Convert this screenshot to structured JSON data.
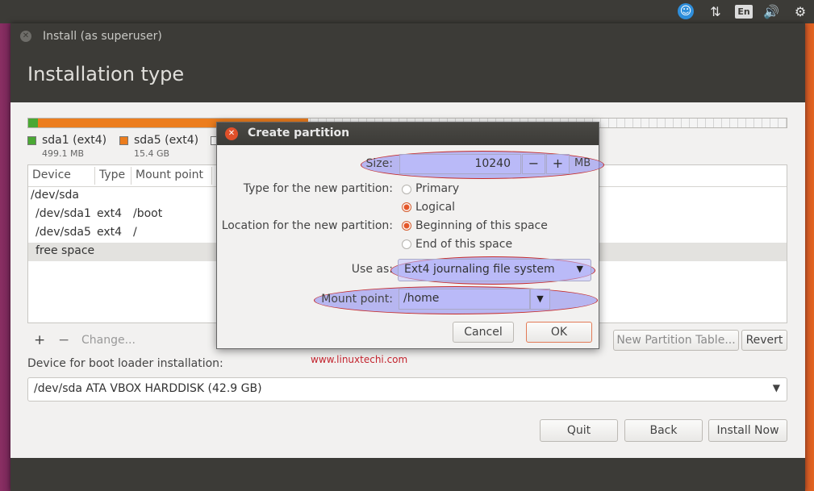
{
  "panel": {
    "language": "En"
  },
  "window": {
    "title": "Install (as superuser)",
    "page_title": "Installation type"
  },
  "legend": [
    {
      "name": "sda1 (ext4)",
      "size": "499.1 MB",
      "color": "#4aa834"
    },
    {
      "name": "sda5 (ext4)",
      "size": "15.4 GB",
      "color": "#ec7d1e"
    }
  ],
  "table": {
    "columns": [
      "Device",
      "Type",
      "Mount point"
    ],
    "rows": [
      {
        "device": "/dev/sda",
        "type": "",
        "mount": ""
      },
      {
        "device": "/dev/sda1",
        "type": "ext4",
        "mount": "/boot"
      },
      {
        "device": "/dev/sda5",
        "type": "ext4",
        "mount": "/"
      },
      {
        "device": "free space",
        "type": "",
        "mount": ""
      }
    ]
  },
  "toolbar": {
    "add": "+",
    "remove": "−",
    "change": "Change...",
    "new_table": "New Partition Table...",
    "revert": "Revert"
  },
  "bootloader": {
    "label": "Device for boot loader installation:",
    "value": "/dev/sda   ATA VBOX HARDDISK (42.9 GB)"
  },
  "buttons": {
    "quit": "Quit",
    "back": "Back",
    "install": "Install Now"
  },
  "dialog": {
    "title": "Create partition",
    "size_label": "Size:",
    "size_value": "10240",
    "size_minus": "−",
    "size_plus": "+",
    "size_unit": "MB",
    "type_label": "Type for the new partition:",
    "type_options": [
      "Primary",
      "Logical"
    ],
    "type_selected": "Logical",
    "location_label": "Location for the new partition:",
    "location_options": [
      "Beginning of this space",
      "End of this space"
    ],
    "location_selected": "Beginning of this space",
    "useas_label": "Use as:",
    "useas_value": "Ext4 journaling file system",
    "mount_label": "Mount point:",
    "mount_value": "/home",
    "cancel": "Cancel",
    "ok": "OK"
  },
  "watermark": "www.linuxtechi.com",
  "colors": {
    "accent": "#e4572a",
    "highlight": "#9696f0",
    "highlight_border": "#c52a2a"
  }
}
